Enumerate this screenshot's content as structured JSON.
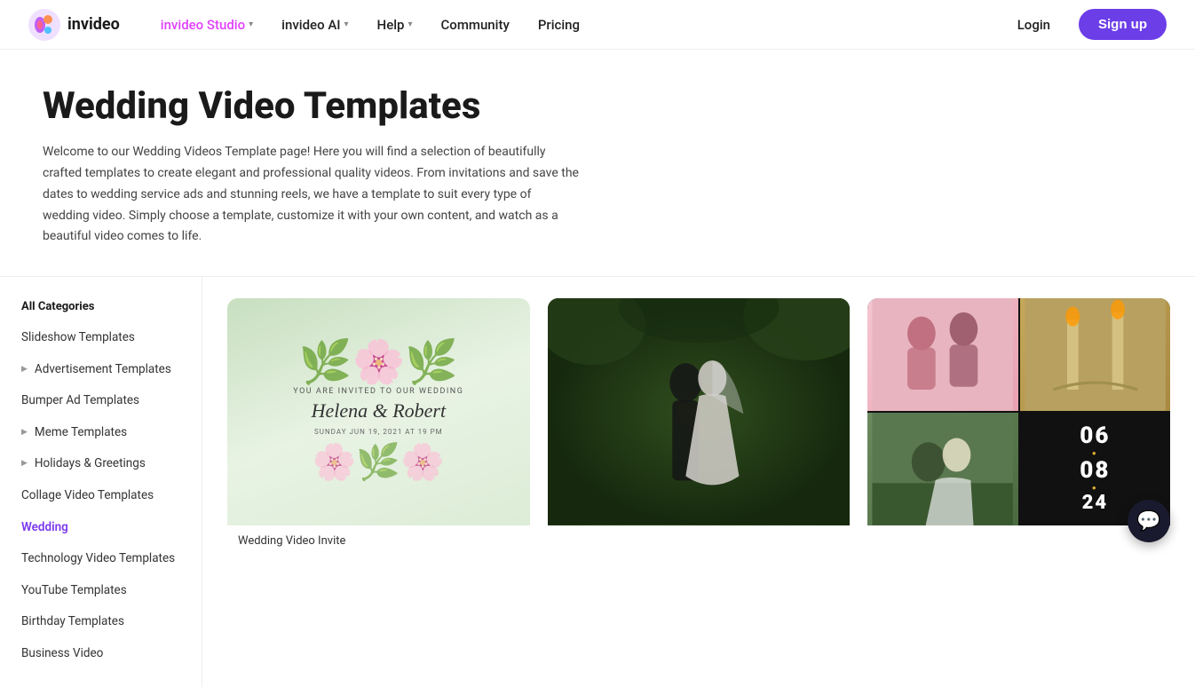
{
  "header": {
    "logo_text": "invideo",
    "nav_items": [
      {
        "label": "invideo Studio",
        "has_dropdown": true,
        "active": true
      },
      {
        "label": "invideo AI",
        "has_dropdown": true
      },
      {
        "label": "Help",
        "has_dropdown": true
      },
      {
        "label": "Community",
        "has_dropdown": false
      },
      {
        "label": "Pricing",
        "has_dropdown": false
      }
    ],
    "login_label": "Login",
    "signup_label": "Sign up"
  },
  "hero": {
    "title": "Wedding Video Templates",
    "description": "Welcome to our Wedding Videos Template page! Here you will find a selection of beautifully crafted templates to create elegant and professional quality videos. From invitations and save the dates to wedding service ads and stunning reels, we have a template to suit every type of wedding video. Simply choose a template, customize it with your own content, and watch as a beautiful video comes to life."
  },
  "sidebar": {
    "section_title": "All Categories",
    "items": [
      {
        "label": "Slideshow Templates",
        "has_arrow": false
      },
      {
        "label": "Advertisement Templates",
        "has_arrow": true
      },
      {
        "label": "Bumper Ad Templates",
        "has_arrow": false
      },
      {
        "label": "Meme Templates",
        "has_arrow": true
      },
      {
        "label": "Holidays & Greetings",
        "has_arrow": true
      },
      {
        "label": "Collage Video Templates",
        "has_arrow": false
      },
      {
        "label": "Wedding",
        "has_arrow": false,
        "active": true
      },
      {
        "label": "Technology Video Templates",
        "has_arrow": false
      },
      {
        "label": "YouTube Templates",
        "has_arrow": false
      },
      {
        "label": "Birthday Templates",
        "has_arrow": false
      },
      {
        "label": "Business Video",
        "has_arrow": false
      }
    ]
  },
  "templates": [
    {
      "id": "wedding-invite",
      "label": "Wedding Video Invite",
      "type": "invite",
      "invite_tagline": "YOU ARE INVITED TO OUR WEDDING",
      "invite_names": "Helena & Robert",
      "invite_date": "SUNDAY JUN 19, 2021 AT 19 PM"
    },
    {
      "id": "wedding-photo1",
      "label": "",
      "type": "photo1"
    },
    {
      "id": "wedding-collage",
      "label": "",
      "type": "collage",
      "numbers": [
        "06",
        "08",
        "24"
      ]
    }
  ],
  "chat": {
    "icon": "💬"
  }
}
